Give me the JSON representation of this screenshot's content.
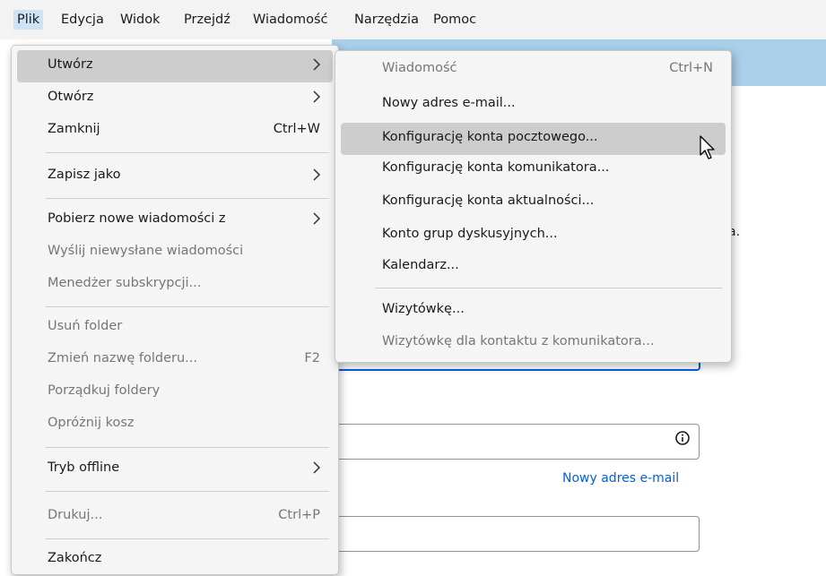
{
  "menubar": {
    "items": [
      {
        "label": "Plik",
        "active": true
      },
      {
        "label": "Edycja"
      },
      {
        "label": "Widok"
      },
      {
        "label": "Przejdź"
      },
      {
        "label": "Wiadomość"
      },
      {
        "label": "Narzędzia"
      },
      {
        "label": "Pomoc"
      }
    ]
  },
  "background": {
    "partial_text": "a.",
    "link": "Nowy adres e-mail"
  },
  "file_menu": {
    "items": [
      {
        "label": "Utwórz",
        "submenu": true,
        "highlighted": true
      },
      {
        "label": "Otwórz",
        "submenu": true
      },
      {
        "label": "Zamknij",
        "shortcut": "Ctrl+W"
      },
      {
        "label": "Zapisz jako",
        "submenu": true
      },
      {
        "label": "Pobierz nowe wiadomości z",
        "submenu": true
      },
      {
        "label": "Wyślij niewysłane wiadomości",
        "disabled": true
      },
      {
        "label": "Menedżer subskrypcji...",
        "disabled": true
      },
      {
        "label": "Usuń folder",
        "disabled": true
      },
      {
        "label": "Zmień nazwę folderu...",
        "shortcut": "F2",
        "disabled": true
      },
      {
        "label": "Porządkuj foldery",
        "disabled": true
      },
      {
        "label": "Opróżnij kosz",
        "disabled": true
      },
      {
        "label": "Tryb offline",
        "submenu": true
      },
      {
        "label": "Drukuj...",
        "shortcut": "Ctrl+P",
        "disabled": true
      },
      {
        "label": "Zakończ"
      }
    ]
  },
  "new_submenu": {
    "items": [
      {
        "label": "Wiadomość",
        "shortcut": "Ctrl+N",
        "disabled": true
      },
      {
        "label": "Nowy adres e-mail..."
      },
      {
        "label": "Konfigurację konta pocztowego...",
        "highlighted": true
      },
      {
        "label": "Konfigurację konta komunikatora..."
      },
      {
        "label": "Konfigurację konta aktualności..."
      },
      {
        "label": "Konto grup dyskusyjnych..."
      },
      {
        "label": "Kalendarz..."
      },
      {
        "label": "Wizytówkę..."
      },
      {
        "label": "Wizytówkę dla kontaktu z komunikatora...",
        "disabled": true
      }
    ]
  },
  "colors": {
    "accent": "#0060df",
    "blue_band": "#a9cfe9",
    "menu_bg": "#f5f5f5",
    "highlight": "#cdcdcd",
    "disabled_text": "#767676"
  },
  "icons": [
    "chevron-right-icon",
    "info-icon",
    "mouse-pointer-icon"
  ]
}
